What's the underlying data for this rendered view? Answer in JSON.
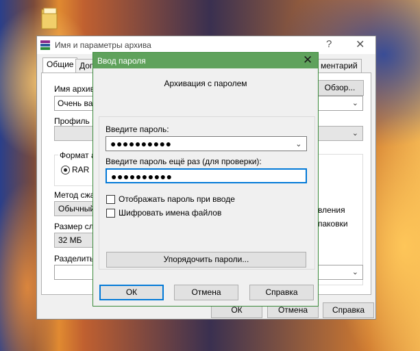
{
  "main_window": {
    "title": "Имя и параметры архива",
    "help": "?",
    "close": "✕",
    "tabs": [
      "Общие",
      "Доп",
      "ментарий"
    ],
    "archive_name_label": "Имя архива",
    "archive_name_value": "Очень важ",
    "browse_button": "Обзор...",
    "profile_label": "Профиль по",
    "format_label": "Формат ар",
    "format_rar": "RAR",
    "method_label": "Метод сжа",
    "method_value": "Обычный",
    "dict_label": "Размер слов",
    "dict_value": "32 МБ",
    "split_label": "Разделить",
    "right_text_1": "вления",
    "right_text_2": "паковки",
    "ok_button": "ОК",
    "cancel_button": "Отмена",
    "help_button": "Справка"
  },
  "dialog": {
    "title": "Ввод пароля",
    "close": "✕",
    "heading": "Архивация с паролем",
    "password_label": "Введите пароль:",
    "password_value": "●●●●●●●●●●",
    "confirm_label": "Введите пароль ещё раз (для проверки):",
    "confirm_value": "●●●●●●●●●●",
    "show_password_label": "Отображать пароль при вводе",
    "encrypt_names_label": "Шифровать имена файлов",
    "organize_button": "Упорядочить пароли...",
    "ok_button": "ОК",
    "cancel_button": "Отмена",
    "help_button": "Справка"
  }
}
